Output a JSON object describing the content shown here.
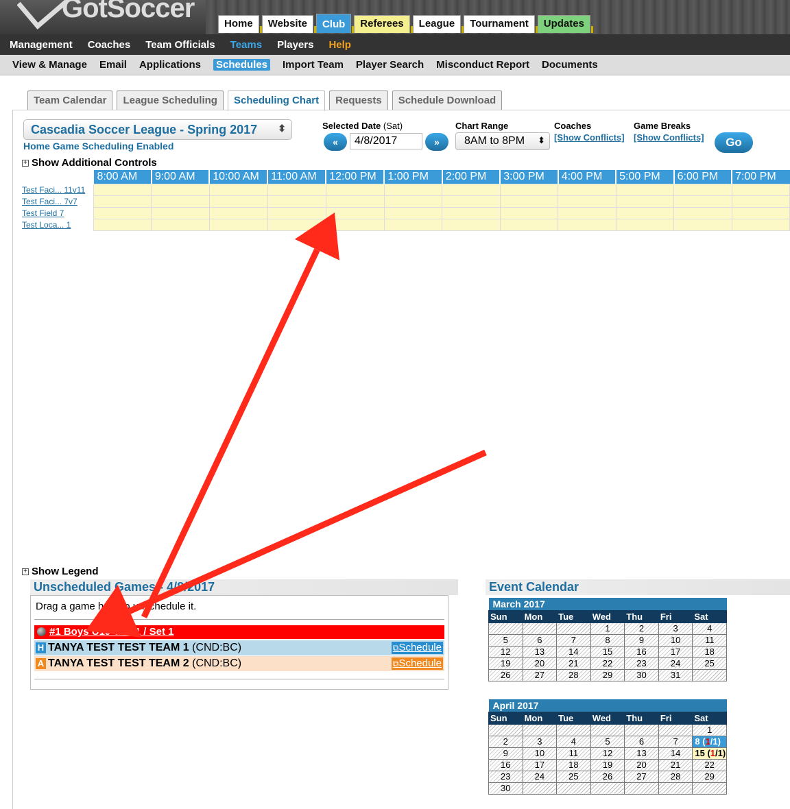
{
  "header": {
    "logo_text": "GotSoccer",
    "tabs": [
      "Home",
      "Website",
      "Club",
      "Referees",
      "League",
      "Tournament",
      "Updates"
    ]
  },
  "nav1": [
    "Management",
    "Coaches",
    "Team Officials",
    "Teams",
    "Players",
    "Help"
  ],
  "nav2": [
    "View & Manage",
    "Email",
    "Applications",
    "Schedules",
    "Import Team",
    "Player Search",
    "Misconduct Report",
    "Documents"
  ],
  "subtabs": [
    "Team Calendar",
    "League Scheduling",
    "Scheduling Chart",
    "Requests",
    "Schedule Download"
  ],
  "controls": {
    "league": "Cascadia Soccer League - Spring 2017",
    "home_enabled": "Home Game Scheduling Enabled",
    "selected_date_label": "Selected Date",
    "selected_date_day": "(Sat)",
    "date_value": "4/8/2017",
    "prev": "«",
    "next": "»",
    "chart_range_label": "Chart Range",
    "chart_range_value": "8AM to 8PM",
    "coaches_label": "Coaches",
    "game_breaks_label": "Game Breaks",
    "show_conflicts": "[Show Conflicts]",
    "go": "Go",
    "show_additional": "Show Additional Controls"
  },
  "chart": {
    "times": [
      "8:00 AM",
      "9:00 AM",
      "10:00 AM",
      "11:00 AM",
      "12:00 PM",
      "1:00 PM",
      "2:00 PM",
      "3:00 PM",
      "4:00 PM",
      "5:00 PM",
      "6:00 PM",
      "7:00 PM"
    ],
    "fields": [
      "Test Faci... 11v11",
      "Test Faci... 7v7",
      "Test Field 7",
      "Test Loca... 1"
    ]
  },
  "legend": "Show Legend",
  "unscheduled": {
    "title": "Unscheduled Games - 4/8/2017",
    "hint": "Drag a game here to unschedule it.",
    "game": "#1 Boys U19 Tier 1 / Set 1",
    "home_badge": "H",
    "away_badge": "A",
    "home_team": "TANYA TEST TEST TEAM 1",
    "home_code": "(CND:BC)",
    "away_team": "TANYA TEST TEST TEAM 2",
    "away_code": "(CND:BC)",
    "schedule": "Schedule",
    "home_color": "#b7d9ea",
    "away_color": "#fde0c8"
  },
  "event_calendar": {
    "title": "Event Calendar",
    "days": [
      "Sun",
      "Mon",
      "Tue",
      "Wed",
      "Thu",
      "Fri",
      "Sat"
    ],
    "months": [
      {
        "name": "March 2017",
        "weeks": [
          [
            "",
            "",
            "",
            "1",
            "2",
            "3",
            "4"
          ],
          [
            "5",
            "6",
            "7",
            "8",
            "9",
            "10",
            "11"
          ],
          [
            "12",
            "13",
            "14",
            "15",
            "16",
            "17",
            "18"
          ],
          [
            "19",
            "20",
            "21",
            "22",
            "23",
            "24",
            "25"
          ],
          [
            "26",
            "27",
            "28",
            "29",
            "30",
            "31",
            ""
          ]
        ]
      },
      {
        "name": "April 2017",
        "weeks": [
          [
            "",
            "",
            "",
            "",
            "",
            "",
            "1"
          ],
          [
            "2",
            "3",
            "4",
            "5",
            "6",
            "7",
            "8 (1/1)"
          ],
          [
            "9",
            "10",
            "11",
            "12",
            "13",
            "14",
            "15 (1/1)"
          ],
          [
            "16",
            "17",
            "18",
            "19",
            "20",
            "21",
            "22"
          ],
          [
            "23",
            "24",
            "25",
            "26",
            "27",
            "28",
            "29"
          ],
          [
            "30",
            "",
            "",
            "",
            "",
            "",
            ""
          ]
        ]
      }
    ]
  },
  "annotation_color": "#ff2a1a"
}
